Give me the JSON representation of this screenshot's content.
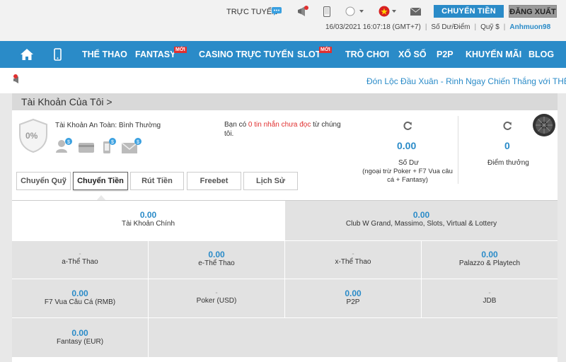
{
  "topbar": {
    "online_label": "TRỰC TUYẾN",
    "transfer_button": "CHUYỂN TIỀN",
    "logout_button": "ĐĂNG XUẤT",
    "datetime": "16/03/2021 16:07:18 (GMT+7)",
    "balance_label": "Số Dư/Điểm",
    "fund_label": "Quỹ $",
    "username": "Anhmuon98"
  },
  "nav": {
    "items": [
      "THỂ THAO",
      "FANTASY",
      "CASINO TRỰC TUYẾN",
      "SLOT",
      "TRÒ CHƠI",
      "XỔ SỐ",
      "P2P",
      "KHUYẾN MÃI",
      "BLOG"
    ],
    "new_badge": "MỚI"
  },
  "marquee": "Đón Lộc Đầu Xuân - Rinh Ngay Chiến Thắng với THẾ T",
  "account": {
    "title": "Tài Khoản Của Tôi >",
    "security_percent": "0%",
    "security_label": "Tài Khoản An Toàn: Bình Thường",
    "msg_pre": "Bạn có ",
    "msg_highlight": "0 tin nhắn chưa đọc",
    "msg_post": " từ chúng tôi.",
    "balance_value": "0.00",
    "balance_label": "Số Dư",
    "balance_note": "(ngoại trừ Poker + F7 Vua câu cá + Fantasy)",
    "points_value": "0",
    "points_label": "Điểm thưởng",
    "tabs": [
      "Chuyển Quỹ",
      "Chuyển Tiền",
      "Rút Tiền",
      "Freebet",
      "Lịch Sử"
    ]
  },
  "wallets": {
    "main": {
      "value": "0.00",
      "label": "Tài Khoản Chính"
    },
    "club": {
      "value": "0.00",
      "label": "Club W Grand, Massimo, Slots, Virtual & Lottery"
    },
    "a_sport": {
      "value": "-",
      "label": "a-Thể Thao"
    },
    "e_sport": {
      "value": "0.00",
      "label": "e-Thể Thao"
    },
    "x_sport": {
      "value": "-",
      "label": "x-Thể Thao"
    },
    "palazzo": {
      "value": "0.00",
      "label": "Palazzo & Playtech"
    },
    "f7": {
      "value": "0.00",
      "label": "F7 Vua Câu Cá (RMB)"
    },
    "poker": {
      "value": "-",
      "label": "Poker (USD)"
    },
    "p2p": {
      "value": "0.00",
      "label": "P2P"
    },
    "jdb": {
      "value": "-",
      "label": "JDB"
    },
    "fantasy": {
      "value": "0.00",
      "label": "Fantasy (EUR)"
    }
  },
  "colors": {
    "brand": "#2a8bc8",
    "alert": "#e03030"
  }
}
